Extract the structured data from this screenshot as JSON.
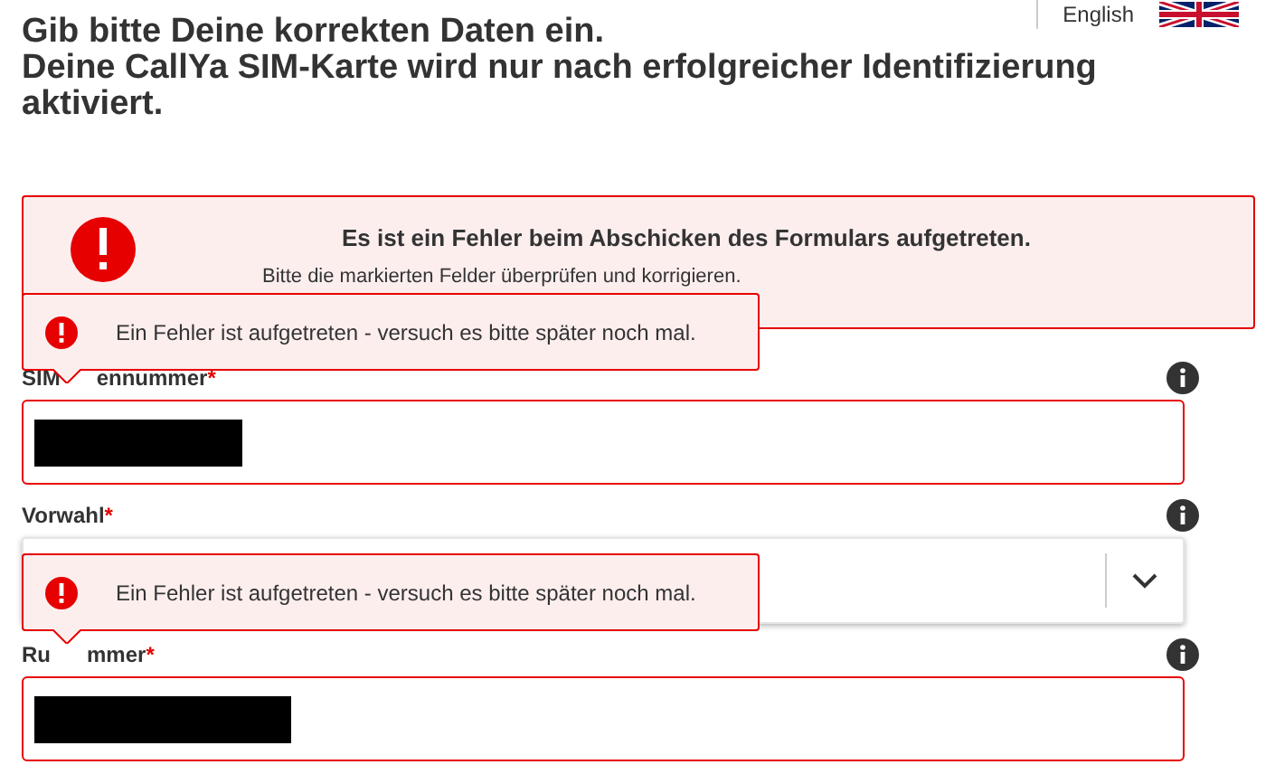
{
  "language": {
    "label": "English"
  },
  "heading": [
    "Gib bitte Deine korrekten Daten ein.",
    "Deine CallYa SIM-Karte wird nur nach erfolgreicher Identifizierung aktiviert."
  ],
  "error_box": {
    "title": "Es ist ein Fehler beim Abschicken des Formulars aufgetreten.",
    "message": "Bitte die markierten Felder überprüfen und korrigieren."
  },
  "required_mark": "*",
  "fields": [
    {
      "kind": "input",
      "label_start": "SIM",
      "label_end": "ennummer",
      "required": true,
      "invalid": true,
      "redacted": true
    },
    {
      "kind": "select",
      "label": "Vorwahl",
      "required": true,
      "invalid": false
    },
    {
      "kind": "input",
      "label_start": "Ru",
      "label_end": "mmer",
      "required": true,
      "invalid": true,
      "redacted": true
    }
  ],
  "tooltips": [
    "Ein Fehler ist aufgetreten - versuch es bitte später noch mal.",
    "Ein Fehler ist aufgetreten - versuch es bitte später noch mal."
  ]
}
